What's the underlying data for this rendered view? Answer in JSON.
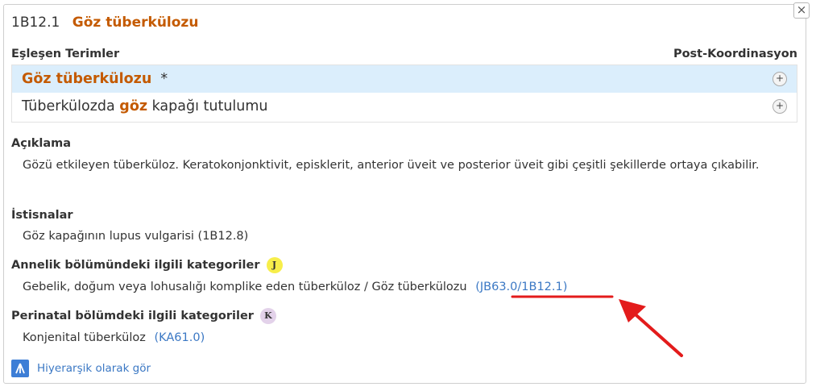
{
  "header": {
    "code": "1B12.1",
    "title": "Göz tüberkülozu"
  },
  "close_label": "×",
  "matching_terms": {
    "label": "Eşleşen Terimler",
    "post_coord_label": "Post-Koordinasyon",
    "items": [
      {
        "highlight": "Göz tüberkülozu",
        "suffix": "  *"
      },
      {
        "prefix": "Tüberkülozda ",
        "highlight": "göz",
        "suffix": " kapağı tutulumu"
      }
    ],
    "plus_label": "+"
  },
  "description": {
    "label": "Açıklama",
    "text": "Gözü etkileyen tüberküloz. Keratokonjonktivit, episklerit, anterior üveit ve posterior üveit gibi çeşitli şekillerde ortaya çıkabilir."
  },
  "exclusions": {
    "label": "İstisnalar",
    "text": "Göz kapağının lupus vulgarisi (1B12.8)"
  },
  "maternal": {
    "label": "Annelik bölümündeki ilgili kategoriler",
    "badge": "J",
    "text": "Gebelik, doğum veya lohusalığı komplike eden tüberküloz / Göz tüberkülozu",
    "link": "(JB63.0/1B12.1)"
  },
  "perinatal": {
    "label": "Perinatal bölümdeki ilgili kategoriler",
    "badge": "K",
    "text": "Konjenital tüberküloz",
    "link": "(KA61.0)"
  },
  "hierarchy_link": {
    "label": "Hiyerarşik olarak gör",
    "icon": "hierarchy-icon"
  },
  "colors": {
    "accent_orange": "#c45a00",
    "link_blue": "#3b78c4",
    "selected_row": "#dbeefc",
    "annotation_red": "#e31b1b"
  }
}
